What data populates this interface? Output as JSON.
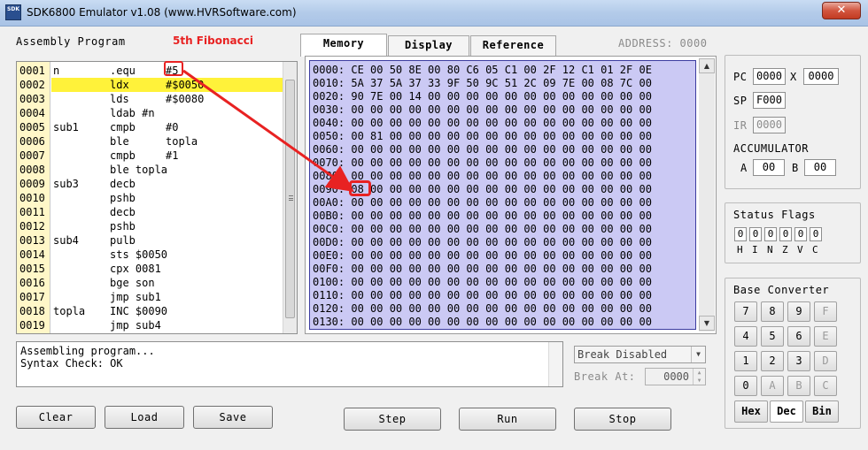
{
  "window": {
    "icon_text": "SDK",
    "title": "SDK6800 Emulator v1.08 (www.HVRSoftware.com)",
    "close_label": "✕"
  },
  "assembly": {
    "heading": "Assembly Program",
    "annotation": "5th Fibonacci",
    "lines": [
      {
        "num": "0001",
        "label": "n",
        "op": ".equ",
        "arg": "#5",
        "highlight": false
      },
      {
        "num": "0002",
        "label": "",
        "op": "ldx",
        "arg": "#$0050",
        "highlight": true
      },
      {
        "num": "0003",
        "label": "",
        "op": "lds",
        "arg": "#$0080",
        "highlight": false
      },
      {
        "num": "0004",
        "label": "",
        "op": "ldab #n",
        "arg": "",
        "highlight": false
      },
      {
        "num": "0005",
        "label": "sub1",
        "op": "cmpb",
        "arg": "#0",
        "highlight": false
      },
      {
        "num": "0006",
        "label": "",
        "op": "ble",
        "arg": "topla",
        "highlight": false
      },
      {
        "num": "0007",
        "label": "",
        "op": "cmpb",
        "arg": "#1",
        "highlight": false
      },
      {
        "num": "0008",
        "label": "",
        "op": "ble topla",
        "arg": "",
        "highlight": false
      },
      {
        "num": "0009",
        "label": "sub3",
        "op": "decb",
        "arg": "",
        "highlight": false
      },
      {
        "num": "0010",
        "label": "",
        "op": "pshb",
        "arg": "",
        "highlight": false
      },
      {
        "num": "0011",
        "label": "",
        "op": "decb",
        "arg": "",
        "highlight": false
      },
      {
        "num": "0012",
        "label": "",
        "op": "pshb",
        "arg": "",
        "highlight": false
      },
      {
        "num": "0013",
        "label": "sub4",
        "op": "pulb",
        "arg": "",
        "highlight": false
      },
      {
        "num": "0014",
        "label": "",
        "op": "sts $0050",
        "arg": "",
        "highlight": false
      },
      {
        "num": "0015",
        "label": "",
        "op": "cpx 0081",
        "arg": "",
        "highlight": false
      },
      {
        "num": "0016",
        "label": "",
        "op": "bge son",
        "arg": "",
        "highlight": false
      },
      {
        "num": "0017",
        "label": "",
        "op": "jmp sub1",
        "arg": "",
        "highlight": false
      },
      {
        "num": "0018",
        "label": "topla",
        "op": "INC $0090",
        "arg": "",
        "highlight": false
      },
      {
        "num": "0019",
        "label": "",
        "op": "jmp sub4",
        "arg": "",
        "highlight": false
      }
    ]
  },
  "output": {
    "lines": [
      "Assembling program...",
      "Syntax Check: OK"
    ]
  },
  "buttons": {
    "clear": "Clear",
    "load": "Load",
    "save": "Save",
    "step": "Step",
    "run": "Run",
    "stop": "Stop"
  },
  "tabs": [
    {
      "label": "Memory",
      "active": true
    },
    {
      "label": "Display",
      "active": false
    },
    {
      "label": "Reference",
      "active": false
    }
  ],
  "address_label": "ADDRESS: 0000",
  "memory": {
    "rows": [
      {
        "addr": "0000:",
        "bytes": "CE 00 50 8E 00 80 C6 05 C1 00 2F 12 C1 01 2F 0E"
      },
      {
        "addr": "0010:",
        "bytes": "5A 37 5A 37 33 9F 50 9C 51 2C 09 7E 00 08 7C 00"
      },
      {
        "addr": "0020:",
        "bytes": "90 7E 00 14 00 00 00 00 00 00 00 00 00 00 00 00"
      },
      {
        "addr": "0030:",
        "bytes": "00 00 00 00 00 00 00 00 00 00 00 00 00 00 00 00"
      },
      {
        "addr": "0040:",
        "bytes": "00 00 00 00 00 00 00 00 00 00 00 00 00 00 00 00"
      },
      {
        "addr": "0050:",
        "bytes": "00 81 00 00 00 00 00 00 00 00 00 00 00 00 00 00"
      },
      {
        "addr": "0060:",
        "bytes": "00 00 00 00 00 00 00 00 00 00 00 00 00 00 00 00"
      },
      {
        "addr": "0070:",
        "bytes": "00 00 00 00 00 00 00 00 00 00 00 00 00 00 00 00"
      },
      {
        "addr": "0080:",
        "bytes": "00 00 00 00 00 00 00 00 00 00 00 00 00 00 00 00"
      },
      {
        "addr": "0090:",
        "bytes": "08 00 00 00 00 00 00 00 00 00 00 00 00 00 00 00"
      },
      {
        "addr": "00A0:",
        "bytes": "00 00 00 00 00 00 00 00 00 00 00 00 00 00 00 00"
      },
      {
        "addr": "00B0:",
        "bytes": "00 00 00 00 00 00 00 00 00 00 00 00 00 00 00 00"
      },
      {
        "addr": "00C0:",
        "bytes": "00 00 00 00 00 00 00 00 00 00 00 00 00 00 00 00"
      },
      {
        "addr": "00D0:",
        "bytes": "00 00 00 00 00 00 00 00 00 00 00 00 00 00 00 00"
      },
      {
        "addr": "00E0:",
        "bytes": "00 00 00 00 00 00 00 00 00 00 00 00 00 00 00 00"
      },
      {
        "addr": "00F0:",
        "bytes": "00 00 00 00 00 00 00 00 00 00 00 00 00 00 00 00"
      },
      {
        "addr": "0100:",
        "bytes": "00 00 00 00 00 00 00 00 00 00 00 00 00 00 00 00"
      },
      {
        "addr": "0110:",
        "bytes": "00 00 00 00 00 00 00 00 00 00 00 00 00 00 00 00"
      },
      {
        "addr": "0120:",
        "bytes": "00 00 00 00 00 00 00 00 00 00 00 00 00 00 00 00"
      },
      {
        "addr": "0130:",
        "bytes": "00 00 00 00 00 00 00 00 00 00 00 00 00 00 00 00"
      }
    ]
  },
  "registers": {
    "pc_label": "PC",
    "pc": "0000",
    "x_label": "X",
    "x": "0000",
    "sp_label": "SP",
    "sp": "F000",
    "ir_label": "IR",
    "ir": "0000",
    "accumulator_label": "ACCUMULATOR",
    "a_label": "A",
    "a": "00",
    "b_label": "B",
    "b": "00"
  },
  "status_flags": {
    "heading": "Status Flags",
    "flags": [
      {
        "name": "H",
        "value": "0"
      },
      {
        "name": "I",
        "value": "0"
      },
      {
        "name": "N",
        "value": "0"
      },
      {
        "name": "Z",
        "value": "0"
      },
      {
        "name": "V",
        "value": "0"
      },
      {
        "name": "C",
        "value": "0"
      }
    ]
  },
  "base_converter": {
    "heading": "Base Converter",
    "keys": [
      {
        "label": "7",
        "enabled": true
      },
      {
        "label": "8",
        "enabled": true
      },
      {
        "label": "9",
        "enabled": true
      },
      {
        "label": "F",
        "enabled": false
      },
      {
        "label": "4",
        "enabled": true
      },
      {
        "label": "5",
        "enabled": true
      },
      {
        "label": "6",
        "enabled": true
      },
      {
        "label": "E",
        "enabled": false
      },
      {
        "label": "1",
        "enabled": true
      },
      {
        "label": "2",
        "enabled": true
      },
      {
        "label": "3",
        "enabled": true
      },
      {
        "label": "D",
        "enabled": false
      },
      {
        "label": "0",
        "enabled": true
      },
      {
        "label": "A",
        "enabled": false
      },
      {
        "label": "B",
        "enabled": false
      },
      {
        "label": "C",
        "enabled": false
      }
    ],
    "modes": [
      {
        "label": "Hex",
        "selected": false
      },
      {
        "label": "Dec",
        "selected": true
      },
      {
        "label": "Bin",
        "selected": false
      }
    ]
  },
  "breakpoint": {
    "mode_selected": "Break Disabled",
    "at_label": "Break At:",
    "at_value": "0000"
  },
  "colors": {
    "annotation": "#e82222",
    "memory_bg": "#cbc9f4",
    "line_highlight": "#fff23a",
    "gutter": "#fff7c8"
  }
}
